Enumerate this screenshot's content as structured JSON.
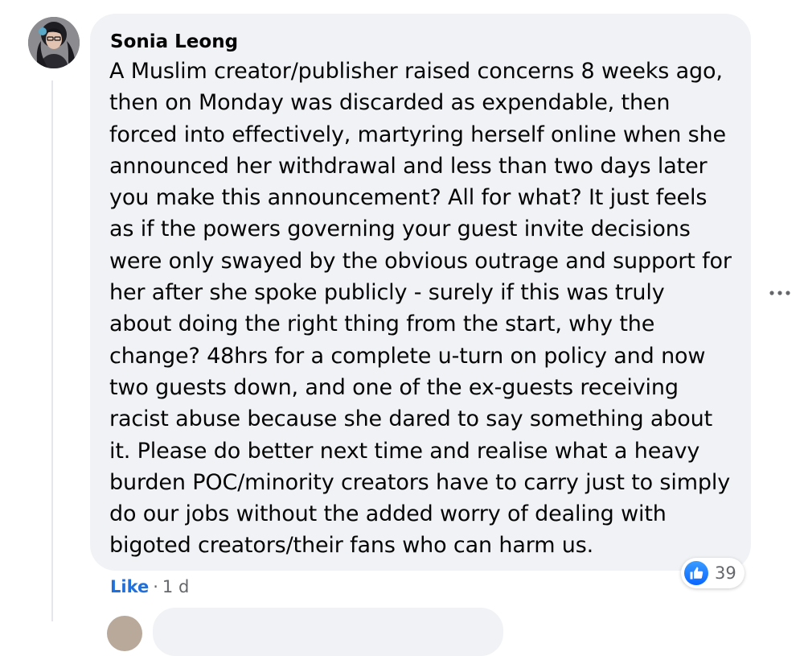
{
  "comment": {
    "author": "Sonia Leong",
    "text": "A Muslim creator/publisher raised concerns 8 weeks ago, then on Monday was discarded as expendable, then forced into effectively, martyring herself online when she announced her withdrawal and less than two days later you make this announcement? All for what? It just feels as if the powers governing your guest invite decisions were only swayed by the obvious outrage and support for her after she spoke publicly - surely if this was truly about doing the right thing from the start, why the change? 48hrs for a complete u-turn on policy and now two guests down, and one of the ex-guests receiving racist abuse because she dared to say something about it. Please do better next time and realise what a heavy burden POC/minority creators have to carry just to simply do our jobs without the added worry of dealing with bigoted creators/their fans who can harm us.",
    "more_icon": "more-horizontal-icon",
    "actions": {
      "like_label": "Like",
      "separator": "·",
      "time": "1 d"
    },
    "reactions": {
      "icon": "thumbs-up-icon",
      "count": "39"
    }
  },
  "colors": {
    "bubble_bg": "#f0f2f5",
    "like_blue": "#216fdb",
    "reaction_blue": "#0866ff",
    "secondary_text": "#65676b"
  }
}
